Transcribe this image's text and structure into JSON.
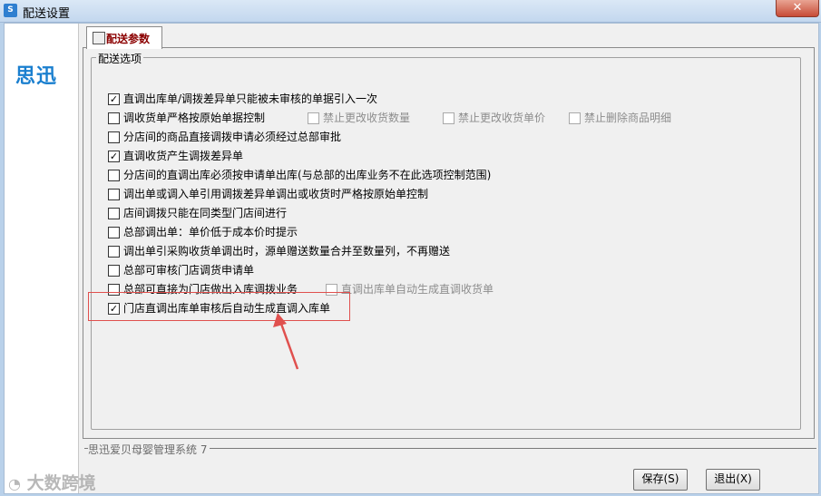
{
  "window": {
    "title": "配送设置",
    "close_glyph": "✕"
  },
  "sidebar": {
    "logo_text": "思迅"
  },
  "tab": {
    "label": "配送参数"
  },
  "group": {
    "title": "配送选项"
  },
  "options": [
    {
      "label": "直调出库单/调拨差异单只能被未审核的单据引入一次",
      "checked": true,
      "mark": "✓",
      "disabled": false
    },
    {
      "label": "调收货单严格按原始单据控制",
      "checked": false,
      "mark": "",
      "disabled": false
    },
    {
      "label": "禁止更改收货数量",
      "checked": false,
      "mark": "",
      "disabled": true
    },
    {
      "label": "禁止更改收货单价",
      "checked": false,
      "mark": "",
      "disabled": true
    },
    {
      "label": "禁止删除商品明细",
      "checked": false,
      "mark": "",
      "disabled": true
    },
    {
      "label": "分店间的商品直接调拨申请必须经过总部审批",
      "checked": false,
      "mark": "",
      "disabled": false
    },
    {
      "label": "直调收货产生调拨差异单",
      "checked": true,
      "mark": "✓",
      "disabled": false
    },
    {
      "label": "分店间的直调出库必须按申请单出库(与总部的出库业务不在此选项控制范围)",
      "checked": false,
      "mark": "",
      "disabled": false
    },
    {
      "label": "调出单或调入单引用调拨差异单调出或收货时严格按原始单控制",
      "checked": false,
      "mark": "",
      "disabled": false
    },
    {
      "label": "店间调拨只能在同类型门店间进行",
      "checked": false,
      "mark": "",
      "disabled": false
    },
    {
      "label": "总部调出单：单价低于成本价时提示",
      "checked": false,
      "mark": "",
      "disabled": false
    },
    {
      "label": "调出单引采购收货单调出时，源单赠送数量合并至数量列，不再赠送",
      "checked": false,
      "mark": "",
      "disabled": false
    },
    {
      "label": "总部可审核门店调货申请单",
      "checked": false,
      "mark": "",
      "disabled": false
    },
    {
      "label": "总部可直接为门店做出入库调拨业务",
      "checked": false,
      "mark": "",
      "disabled": false
    },
    {
      "label": "直调出库单自动生成直调收货单",
      "checked": false,
      "mark": "",
      "disabled": true
    },
    {
      "label": "门店直调出库单审核后自动生成直调入库单",
      "checked": true,
      "mark": "✓",
      "disabled": false
    }
  ],
  "status": {
    "text": "思迅爱贝母婴管理系统 7"
  },
  "buttons": {
    "save": "保存(S)",
    "exit": "退出(X)"
  },
  "watermark": {
    "text": "大数跨境"
  },
  "colors": {
    "highlight": "#e0504e",
    "tab_label": "#8b0000",
    "logo": "#1a7fcf"
  }
}
